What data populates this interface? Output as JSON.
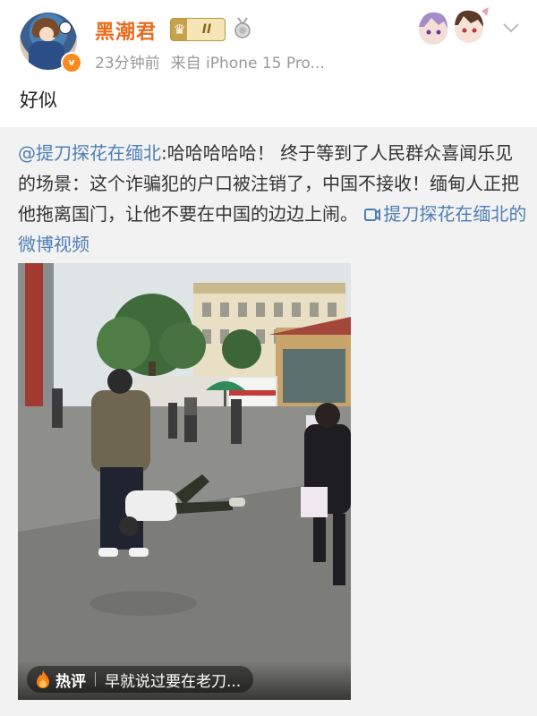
{
  "post": {
    "username": "黑潮君",
    "level_badge": "II",
    "verified_mark": "v",
    "time": "23分钟前",
    "source": "来自 iPhone 15 Pro...",
    "text": "好似"
  },
  "repost": {
    "mention": "@提刀探花在缅北",
    "body": ":哈哈哈哈哈！ 终于等到了人民群众喜闻乐见的场景：这个诈骗犯的户口被注销了，中国不接收！缅甸人正把他拖离国门，让他不要在中国的边边上闹。",
    "video_link": "提刀探花在缅北的微博视频"
  },
  "media": {
    "hot_label": "热评",
    "hot_comment": "早就说过要在老刀..."
  },
  "icons": {
    "crown": "crown-icon",
    "medal": "medal-icon",
    "chevron": "chevron-down-icon",
    "flame": "flame-icon",
    "video": "video-link-icon"
  },
  "colors": {
    "username": "#e86b1c",
    "link": "#4f7db5",
    "meta": "#999999",
    "repost_bg": "#f2f2f2"
  }
}
